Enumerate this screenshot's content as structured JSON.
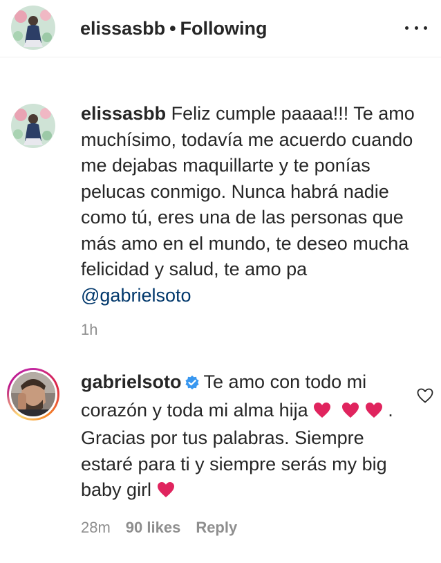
{
  "header": {
    "username": "elissasbb",
    "separator": "•",
    "status": "Following",
    "more_icon": "more-horizontal-icon"
  },
  "comments": [
    {
      "username": "elissasbb",
      "text_part1": "Feliz cumple paaaa!!! Te amo muchísimo, todavía me acuerdo cuando me dejabas maquillarte y te ponías pelucas conmigo. Nunca habrá nadie como tú, eres una de las personas que más amo en el mundo, te deseo mucha felicidad y salud, te amo pa ",
      "mention": "@gabrielsoto",
      "time": "1h"
    },
    {
      "username": "gabrielsoto",
      "verified_icon": "verified-badge-icon",
      "text_part1": "Te amo con todo mi corazón y toda mi alma hija ",
      "text_part2": " . Gracias por tus palabras. Siempre estaré para ti y siempre serás my big baby girl ",
      "emoji": "red-heart-emoji",
      "time": "28m",
      "likes": "90 likes",
      "reply": "Reply",
      "like_icon": "heart-outline-icon"
    }
  ],
  "colors": {
    "text": "#262626",
    "muted": "#8e8e8e",
    "mention": "#00376b",
    "verified": "#3897f0",
    "heart": "#e0245e",
    "divider": "#efefef"
  }
}
